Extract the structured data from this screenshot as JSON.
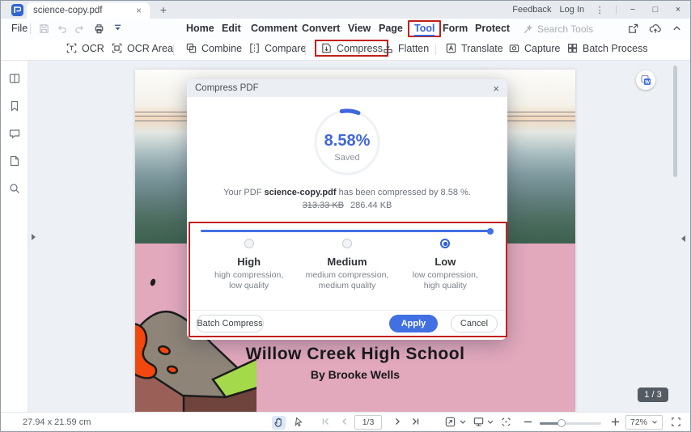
{
  "window": {
    "tab_title": "science-copy.pdf",
    "feedback": "Feedback",
    "login": "Log In"
  },
  "glyphs": {
    "close": "×",
    "minimize": "−",
    "maximize": "□",
    "kebab": "⋮",
    "plus": "+",
    "divider": "|"
  },
  "menu": {
    "file": "File",
    "items": [
      "Home",
      "Edit",
      "Comment",
      "Convert",
      "View",
      "Page",
      "Tool",
      "Form",
      "Protect"
    ],
    "search_placeholder": "Search Tools"
  },
  "toolbar": {
    "items": [
      {
        "label": "OCR"
      },
      {
        "label": "OCR Area"
      },
      {
        "label": "Combine"
      },
      {
        "label": "Compare"
      },
      {
        "label": "Compress"
      },
      {
        "label": "Flatten"
      },
      {
        "label": "Translate"
      },
      {
        "label": "Capture"
      },
      {
        "label": "Batch Process"
      }
    ]
  },
  "dialog": {
    "title": "Compress PDF",
    "percent": "8.58%",
    "saved_label": "Saved",
    "message_prefix": "Your PDF ",
    "message_file": "science-copy.pdf",
    "message_suffix": "  has been compressed by 8.58 %.",
    "old_size": "313.33 KB",
    "new_size": "286.44 KB",
    "options": [
      {
        "label": "High",
        "desc1": "high compression,",
        "desc2": "low quality"
      },
      {
        "label": "Medium",
        "desc1": "medium compression,",
        "desc2": "medium quality"
      },
      {
        "label": "Low",
        "desc1": "low compression,",
        "desc2": "high quality"
      }
    ],
    "batch_button": "Batch Compress",
    "apply_button": "Apply",
    "cancel_button": "Cancel"
  },
  "document": {
    "title": "Willow Creek High School",
    "subtitle": "By Brooke Wells",
    "page_badge": "1 / 3"
  },
  "statusbar": {
    "dimensions": "27.94 x 21.59 cm",
    "page_indicator": "1/3",
    "zoom_level": "72%"
  },
  "colors": {
    "accent": "#4170e2",
    "annotation_red": "#c2201c",
    "page_pink": "#e2a8bc"
  }
}
